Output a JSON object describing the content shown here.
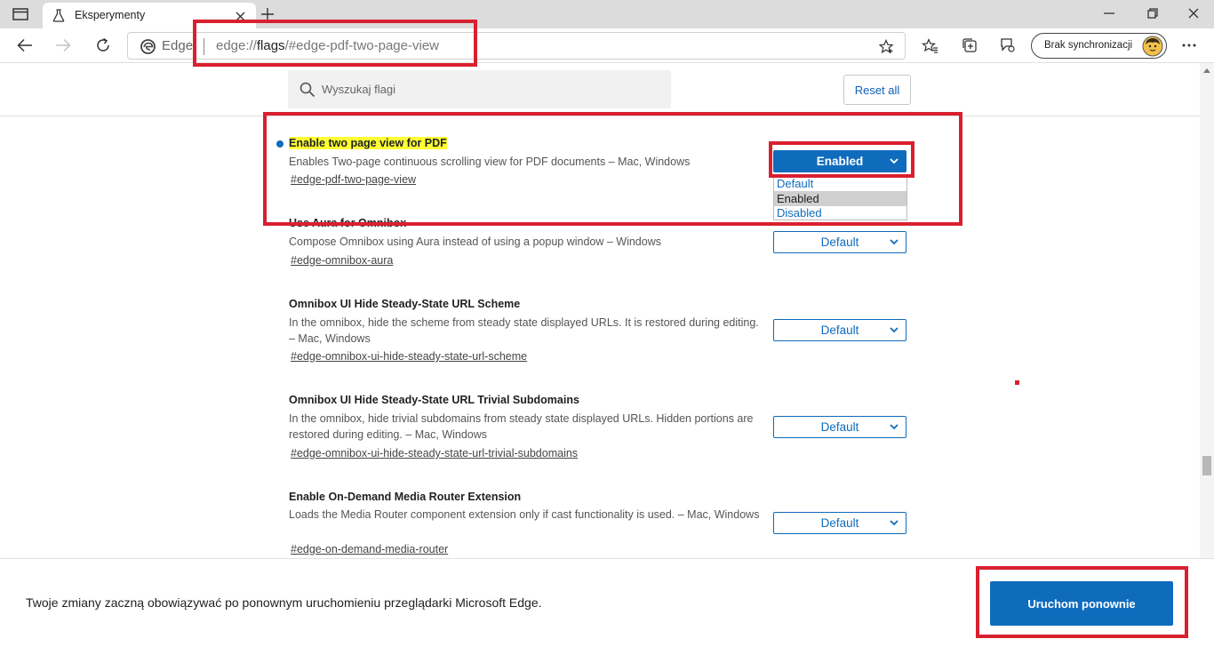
{
  "browser": {
    "tab_title": "Eksperymenty",
    "address_prefix": "Edge",
    "url_scheme": "edge://",
    "url_host": "flags",
    "url_path": "/#edge-pdf-two-page-view",
    "profile_label": "Brak synchronizacji"
  },
  "flags_page": {
    "search_placeholder": "Wyszukaj flagi",
    "reset_label": "Reset all",
    "flags": [
      {
        "title": "Enable two page view for PDF",
        "description": "Enables Two-page continuous scrolling view for PDF documents – Mac, Windows",
        "link": "#edge-pdf-two-page-view",
        "value": "Enabled"
      },
      {
        "title": "Use Aura for Omnibox",
        "description": "Compose Omnibox using Aura instead of using a popup window – Windows",
        "link": "#edge-omnibox-aura",
        "value": "Default"
      },
      {
        "title": "Omnibox UI Hide Steady-State URL Scheme",
        "description": "In the omnibox, hide the scheme from steady state displayed URLs. It is restored during editing. – Mac, Windows",
        "link": "#edge-omnibox-ui-hide-steady-state-url-scheme",
        "value": "Default"
      },
      {
        "title": "Omnibox UI Hide Steady-State URL Trivial Subdomains",
        "description": "In the omnibox, hide trivial subdomains from steady state displayed URLs. Hidden portions are restored during editing. – Mac, Windows",
        "link": "#edge-omnibox-ui-hide-steady-state-url-trivial-subdomains",
        "value": "Default"
      },
      {
        "title": "Enable On-Demand Media Router Extension",
        "description": "Loads the Media Router component extension only if cast functionality is used. – Mac, Windows",
        "link": "#edge-on-demand-media-router",
        "value": "Default"
      }
    ],
    "dropdown_options": [
      "Default",
      "Enabled",
      "Disabled"
    ]
  },
  "footer": {
    "message": "Twoje zmiany zaczną obowiązywać po ponownym uruchomieniu przeglądarki Microsoft Edge.",
    "restart_label": "Uruchom ponownie"
  },
  "colors": {
    "accent": "#0f6cbd",
    "highlight": "#ffff33",
    "annotation": "#d9202f"
  }
}
